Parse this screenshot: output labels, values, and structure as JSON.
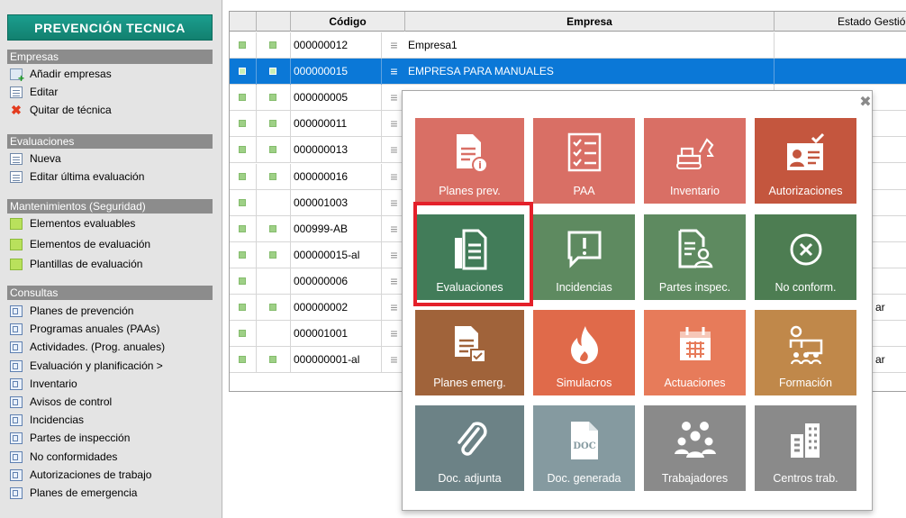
{
  "sidebar": {
    "title": "PREVENCIÓN TECNICA",
    "sections": [
      {
        "title": "Empresas",
        "items": [
          {
            "label": "Añadir empresas",
            "icon": "add-company-icon"
          },
          {
            "label": "Editar",
            "icon": "edit-document-icon"
          },
          {
            "label": "Quitar de técnica",
            "icon": "remove-x-icon"
          }
        ]
      },
      {
        "title": "Evaluaciones",
        "items": [
          {
            "label": "Nueva",
            "icon": "new-document-icon"
          },
          {
            "label": "Editar última evaluación",
            "icon": "edit-document-icon"
          }
        ]
      },
      {
        "title": "Mantenimientos (Seguridad)",
        "items": [
          {
            "label": "Elementos evaluables",
            "icon": "green-square-icon"
          },
          {
            "label": "Elementos de evaluación",
            "icon": "green-square-icon"
          },
          {
            "label": "Plantillas de evaluación",
            "icon": "green-square-icon"
          }
        ]
      },
      {
        "title": "Consultas",
        "items": [
          {
            "label": "Planes de prevención",
            "icon": "report-icon"
          },
          {
            "label": "Programas anuales (PAAs)",
            "icon": "report-icon"
          },
          {
            "label": "Actividades. (Prog. anuales)",
            "icon": "report-icon"
          },
          {
            "label": "Evaluación y planificación  >",
            "icon": "report-icon"
          },
          {
            "label": "Inventario",
            "icon": "report-icon"
          },
          {
            "label": "Avisos de control",
            "icon": "report-icon"
          },
          {
            "label": "Incidencias",
            "icon": "report-icon"
          },
          {
            "label": "Partes de inspección",
            "icon": "report-icon"
          },
          {
            "label": "No conformidades",
            "icon": "report-icon"
          },
          {
            "label": "Autorizaciones de trabajo",
            "icon": "report-icon"
          },
          {
            "label": "Planes de emergencia",
            "icon": "report-icon"
          }
        ]
      }
    ]
  },
  "grid": {
    "columns": {
      "codigo": "Código",
      "empresa": "Empresa",
      "estado": "Estado Gestió"
    },
    "selected_row": 1,
    "rows": [
      {
        "codigo": "000000012",
        "empresa": "Empresa1",
        "estado": "",
        "sq2": true
      },
      {
        "codigo": "000000015",
        "empresa": "EMPRESA PARA MANUALES",
        "estado": "",
        "sq2": true
      },
      {
        "codigo": "000000005",
        "empresa": "",
        "estado": "",
        "sq2": true
      },
      {
        "codigo": "000000011",
        "empresa": "",
        "estado": "",
        "sq2": true
      },
      {
        "codigo": "000000013",
        "empresa": "",
        "estado": "",
        "sq2": true
      },
      {
        "codigo": "000000016",
        "empresa": "",
        "estado": "",
        "sq2": true
      },
      {
        "codigo": "000001003",
        "empresa": "",
        "estado": "",
        "sq2": false
      },
      {
        "codigo": "000999-AB",
        "empresa": "",
        "estado": "",
        "sq2": true
      },
      {
        "codigo": "000000015-al",
        "empresa": "",
        "estado": "",
        "sq2": true
      },
      {
        "codigo": "000000006",
        "empresa": "",
        "estado": "",
        "sq2": false
      },
      {
        "codigo": "000000002",
        "empresa": "",
        "estado": "ar",
        "sq2": true
      },
      {
        "codigo": "000001001",
        "empresa": "",
        "estado": "",
        "sq2": false
      },
      {
        "codigo": "000000001-al",
        "empresa": "",
        "estado": "ar",
        "sq2": true
      }
    ]
  },
  "popup": {
    "close_glyph": "✖",
    "tiles": [
      {
        "label": "Planes prev.",
        "icon": "prevention-plan-icon",
        "color": "#d96f65"
      },
      {
        "label": "PAA",
        "icon": "checklist-icon",
        "color": "#d96f65"
      },
      {
        "label": "Inventario",
        "icon": "excavator-icon",
        "color": "#d96f65"
      },
      {
        "label": "Autorizaciones",
        "icon": "authorization-id-icon",
        "color": "#c4563e"
      },
      {
        "label": "Evaluaciones",
        "icon": "evaluation-document-icon",
        "color": "#427c59"
      },
      {
        "label": "Incidencias",
        "icon": "incident-alert-icon",
        "color": "#5e8a60"
      },
      {
        "label": "Partes inspec.",
        "icon": "inspection-report-icon",
        "color": "#5e8a60"
      },
      {
        "label": "No conform.",
        "icon": "nonconformity-x-icon",
        "color": "#4d7d52"
      },
      {
        "label": "Planes emerg.",
        "icon": "emergency-plan-icon",
        "color": "#a0633a"
      },
      {
        "label": "Simulacros",
        "icon": "fire-icon",
        "color": "#e06a4a"
      },
      {
        "label": "Actuaciones",
        "icon": "calendar-icon",
        "color": "#e77b5a"
      },
      {
        "label": "Formación",
        "icon": "training-icon",
        "color": "#c0884a"
      },
      {
        "label": "Doc. adjunta",
        "icon": "paperclip-icon",
        "color": "#6c8286"
      },
      {
        "label": "Doc. generada",
        "icon": "doc-file-icon",
        "color": "#859aa0"
      },
      {
        "label": "Trabajadores",
        "icon": "workers-group-icon",
        "color": "#8a8a8a"
      },
      {
        "label": "Centros trab.",
        "icon": "building-icon",
        "color": "#8a8a8a"
      }
    ],
    "doc_icon_text": "DOC"
  },
  "highlighted_tile": "Evaluaciones",
  "colors": {
    "selection": "#0b78d7",
    "highlight": "#e4202a",
    "header_green": "#1b9e8e"
  }
}
